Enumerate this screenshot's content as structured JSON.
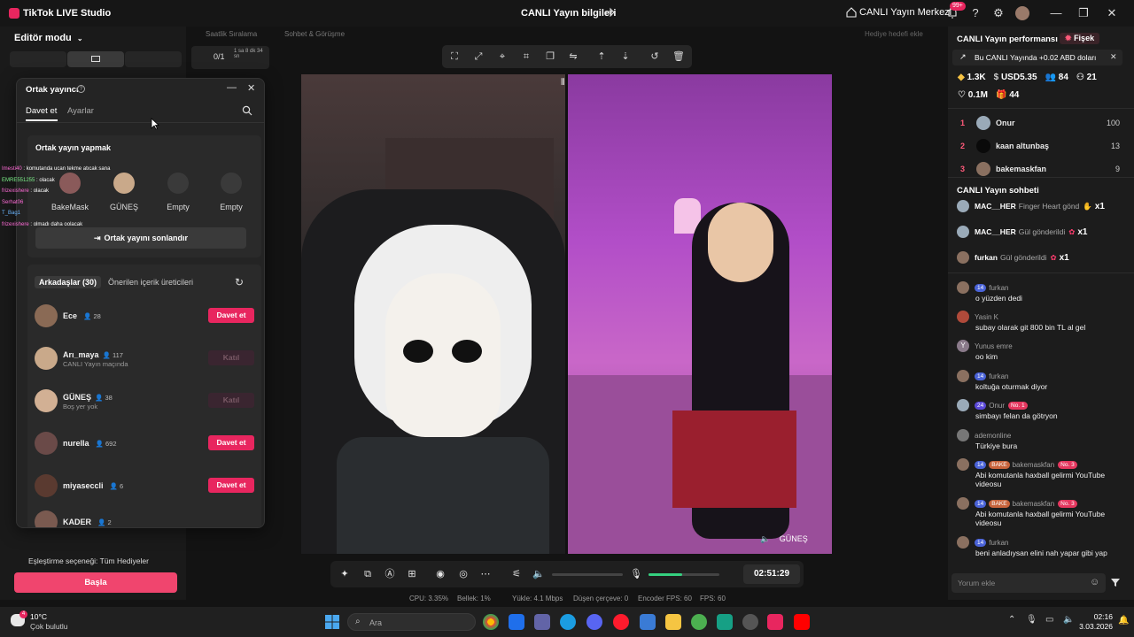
{
  "titlebar": {
    "app_title": "TikTok LIVE Studio",
    "center_title": "CANLI Yayın bilgileri",
    "live_center": "CANLI Yayın Merkezi",
    "notif_badge": "99+"
  },
  "left": {
    "editor_mode": "Editör modu",
    "top_tabs": [
      "Saatlik Sıralama",
      "Sohbet & Görüşme"
    ],
    "counter": "0/1",
    "counter_time": "1 sa 8 dk 34 sn",
    "gift_match": "Eşleştirme seçeneği: Tüm Hediyeler",
    "start_button": "Başla"
  },
  "popup": {
    "title": "Ortak yayıncı",
    "tabs": [
      "Davet et",
      "Ayarlar"
    ],
    "section_title": "Ortak yayın yapmak",
    "slots": [
      "BakeMask",
      "GÜNEŞ",
      "Empty",
      "Empty"
    ],
    "end_button": "Ortak yayını sonlandır",
    "friends_tabs": [
      "Arkadaşlar (30)",
      "Önerilen içerik üreticileri"
    ],
    "friends": [
      {
        "name": "Ece",
        "followers": "28",
        "sub": "",
        "action": "Davet et",
        "enabled": true
      },
      {
        "name": "Arı_maya",
        "followers": "117",
        "sub": "CANLI Yayın maçında",
        "action": "Katıl",
        "enabled": false
      },
      {
        "name": "GÜNEŞ",
        "followers": "38",
        "sub": "Boş yer yok",
        "action": "Katıl",
        "enabled": false
      },
      {
        "name": "nurella",
        "followers": "692",
        "sub": "",
        "action": "Davet et",
        "enabled": true
      },
      {
        "name": "miyaseccli",
        "followers": "6",
        "sub": "",
        "action": "Davet et",
        "enabled": true
      },
      {
        "name": "KADER",
        "followers": "2",
        "sub": "",
        "action": "",
        "enabled": true
      }
    ]
  },
  "overlay_chat": [
    {
      "user": "Imesti40",
      "text": "komutanda ucan tekme atıcak sana"
    },
    {
      "user": "EMRE551255",
      "text": "olacak"
    },
    {
      "user": "frizexishere",
      "text": "olacak"
    },
    {
      "user": "Serhat06",
      "text": ""
    },
    {
      "user": "T_Bag1",
      "text": ""
    },
    {
      "user": "frizexishere",
      "text": "olmadı daha oolacak"
    }
  ],
  "stage": {
    "guest_label": "GÜNEŞ",
    "timer": "02:51:29",
    "hedef": "Hediye hedefi ekle"
  },
  "stats": {
    "cpu": "CPU: 3.35%",
    "memory": "Bellek: 1%",
    "upload": "Yükle: 4.1 Mbps",
    "dropped": "Düşen çerçeve: 0",
    "encoder_fps": "Encoder FPS: 60",
    "fps": "FPS: 60"
  },
  "right": {
    "perf_title": "CANLI Yayın performansı",
    "fiscek": "Fişek",
    "banner": "Bu CANLI Yayında +0.02 ABD doları",
    "metrics": {
      "diamonds": "1.3K",
      "usd": "USD5.35",
      "viewers": "84",
      "users": "21",
      "likes": "0.1M",
      "gifts": "44"
    },
    "ranking": [
      {
        "rank": "1",
        "name": "Onur",
        "score": "100"
      },
      {
        "rank": "2",
        "name": "kaan altunbaş",
        "score": "13"
      },
      {
        "rank": "3",
        "name": "bakemaskfan",
        "score": "9"
      }
    ],
    "chat_title": "CANLI Yayın sohbeti",
    "gifts": [
      {
        "user": "MAC__HER",
        "text": "Finger Heart gönd",
        "count": "x1"
      },
      {
        "user": "MAC__HER",
        "text": "Gül gönderildi",
        "count": "x1"
      },
      {
        "user": "furkan",
        "text": "Gül gönderildi",
        "count": "x1"
      }
    ],
    "messages": [
      {
        "lvl": "14",
        "user": "furkan",
        "text": "o yüzden dedi",
        "tag": "",
        "no": ""
      },
      {
        "lvl": "",
        "user": "Yasin K",
        "text": "subay olarak git 800 bin TL al gel",
        "tag": "",
        "no": ""
      },
      {
        "lvl": "",
        "user": "Yunus emre",
        "text": "oo kim",
        "tag": "",
        "no": ""
      },
      {
        "lvl": "14",
        "user": "furkan",
        "text": "koltuğa oturmak diyor",
        "tag": "",
        "no": ""
      },
      {
        "lvl": "24",
        "user": "Onur",
        "text": "simbayı felan da götryon",
        "tag": "",
        "no": "No. 1"
      },
      {
        "lvl": "",
        "user": "ademonline",
        "text": "Türkiye bura",
        "tag": "",
        "no": ""
      },
      {
        "lvl": "14",
        "user": "bakemaskfan",
        "text": "Abi komutanla haxball gelirmi YouTube videosu",
        "tag": "BAKE",
        "no": "No. 3"
      },
      {
        "lvl": "14",
        "user": "bakemaskfan",
        "text": "Abi komutanla haxball gelirmi YouTube videosu",
        "tag": "BAKE",
        "no": "No. 3"
      },
      {
        "lvl": "14",
        "user": "furkan",
        "text": "beni anladıysan elini nah yapar gibi yap",
        "tag": "",
        "no": ""
      }
    ],
    "comment_placeholder": "Yorum ekle"
  },
  "taskbar": {
    "weather_temp": "10°C",
    "weather_desc": "Çok bulutlu",
    "search": "Ara",
    "time": "02:16",
    "date": "3.03.2026"
  }
}
